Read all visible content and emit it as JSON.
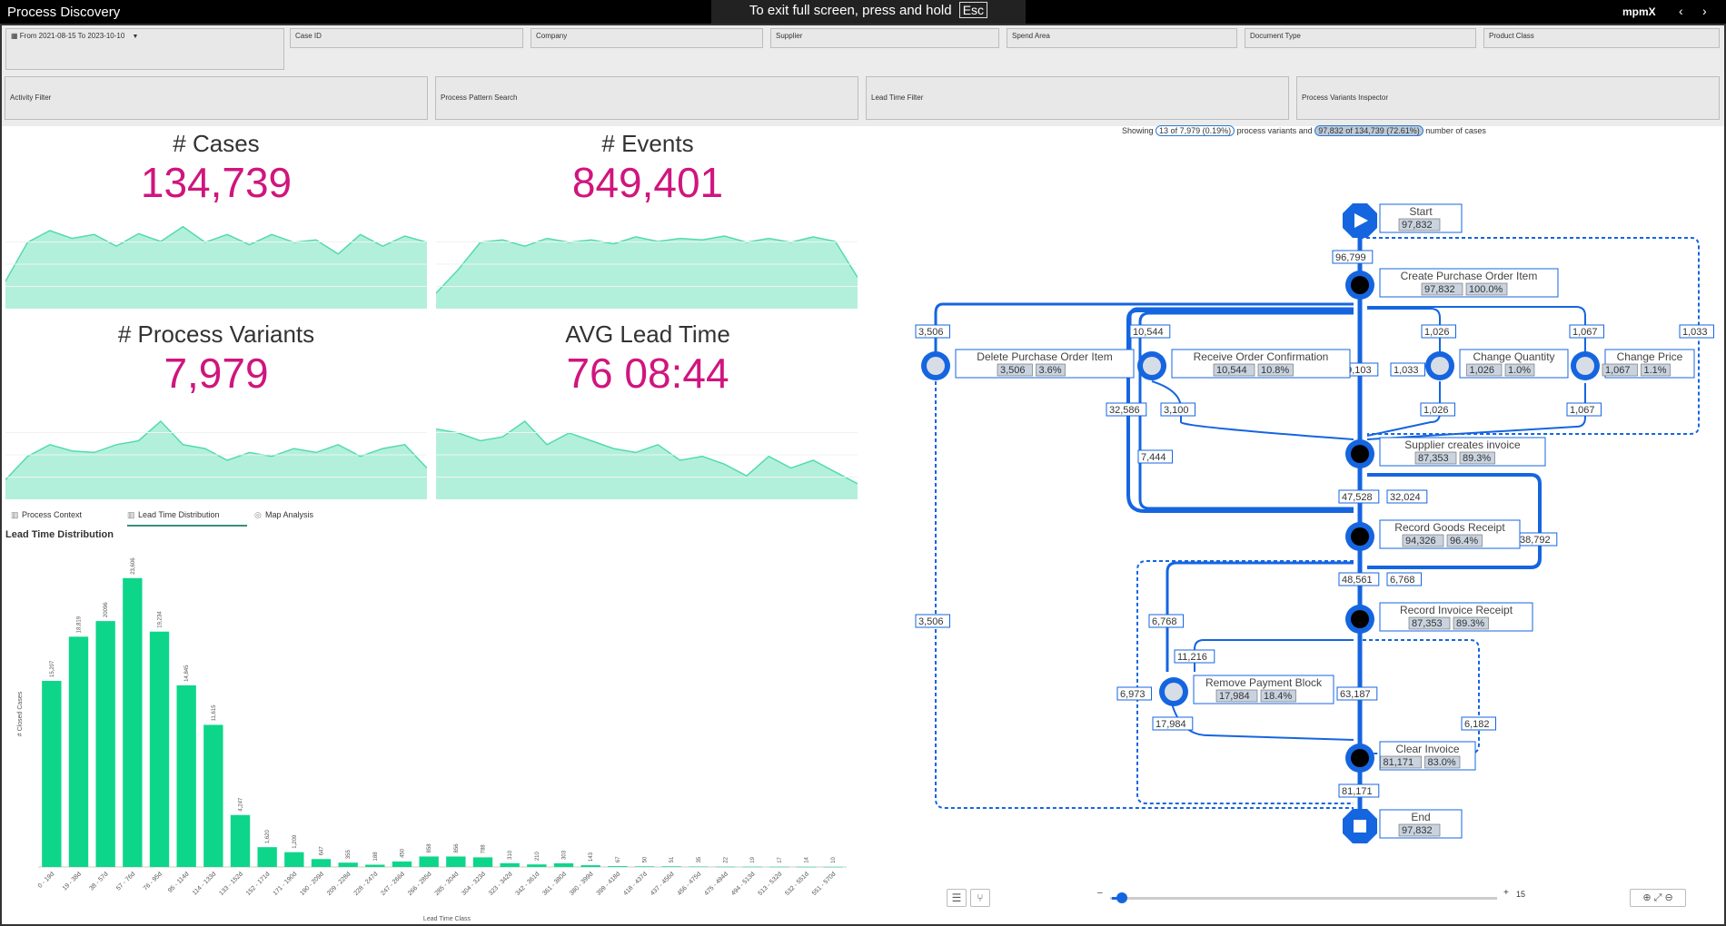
{
  "app": {
    "title": "Process Discovery",
    "logo": "mpmX",
    "fullscreen_notice": "To exit full screen, press and hold",
    "fullscreen_key": "Esc",
    "nav_prev": "‹",
    "nav_next": "›"
  },
  "filters": {
    "date_range": "From 2021-08-15 To 2023-10-10",
    "fields": [
      "Case ID",
      "Company",
      "Supplier",
      "Spend Area",
      "Document Type",
      "Product Class"
    ],
    "panels": [
      "Activity Filter",
      "Process Pattern Search",
      "Lead Time Filter",
      "Process Variants Inspector"
    ]
  },
  "kpis": [
    {
      "label": "# Cases",
      "value": "134,739",
      "trend": [
        0.35,
        0.85,
        1.0,
        0.9,
        0.95,
        0.8,
        0.96,
        0.86,
        1.05,
        0.85,
        0.95,
        0.82,
        0.95,
        0.85,
        0.88,
        0.7,
        0.95,
        0.8,
        0.93,
        0.85
      ]
    },
    {
      "label": "# Events",
      "value": "849,401",
      "trend": [
        0.2,
        0.5,
        0.85,
        0.88,
        0.8,
        0.9,
        0.85,
        0.88,
        0.83,
        0.92,
        0.86,
        0.9,
        0.88,
        0.93,
        0.85,
        0.9,
        0.85,
        0.92,
        0.86,
        0.4
      ]
    },
    {
      "label": "# Process Variants",
      "value": "7,979",
      "trend": [
        0.25,
        0.55,
        0.7,
        0.62,
        0.6,
        0.7,
        0.75,
        1.0,
        0.7,
        0.65,
        0.5,
        0.6,
        0.55,
        0.65,
        0.6,
        0.7,
        0.55,
        0.65,
        0.7,
        0.4
      ]
    },
    {
      "label": "AVG Lead Time",
      "value": "76 08:44",
      "trend": [
        0.9,
        0.85,
        0.75,
        0.8,
        1.0,
        0.7,
        0.85,
        0.75,
        0.65,
        0.6,
        0.7,
        0.5,
        0.55,
        0.45,
        0.3,
        0.55,
        0.4,
        0.5,
        0.35,
        0.2
      ]
    }
  ],
  "colors": {
    "kpi_value": "#d0157e",
    "spark_fill": "#b3f0dc",
    "spark_line": "#52dca9",
    "bar": "#0dd68a",
    "flow_blue": "#1565e0"
  },
  "tabs": [
    {
      "label": "Process Context",
      "icon": "bar-chart-icon"
    },
    {
      "label": "Lead Time Distribution",
      "icon": "bar-chart-icon"
    },
    {
      "label": "Map Analysis",
      "icon": "map-icon"
    }
  ],
  "chart_data": {
    "type": "bar",
    "title": "Lead Time Distribution",
    "xlabel": "Lead Time Class",
    "ylabel": "# Closed Cases",
    "categories": [
      "0 - 19d",
      "19 - 38d",
      "38 - 57d",
      "57 - 76d",
      "76 - 95d",
      "95 - 114d",
      "114 - 133d",
      "133 - 152d",
      "152 - 171d",
      "171 - 190d",
      "190 - 209d",
      "209 - 228d",
      "228 - 247d",
      "247 - 266d",
      "266 - 285d",
      "285 - 304d",
      "304 - 323d",
      "323 - 342d",
      "342 - 361d",
      "361 - 380d",
      "380 - 399d",
      "399 - 418d",
      "418 - 437d",
      "437 - 456d",
      "456 - 475d",
      "475 - 494d",
      "494 - 513d",
      "513 - 532d",
      "532 - 551d",
      "551 - 570d"
    ],
    "values": [
      15207,
      18819,
      20096,
      23606,
      19234,
      14845,
      11615,
      4247,
      1620,
      1209,
      647,
      355,
      188,
      450,
      858,
      856,
      788,
      310,
      210,
      303,
      143,
      67,
      50,
      51,
      35,
      22,
      19,
      17,
      14,
      10
    ],
    "labels": [
      "15,207",
      "18,819",
      "20096",
      "23,606",
      "19,234",
      "14,845",
      "11,615",
      "4,247",
      "1,620",
      "1,209",
      "647",
      "355",
      "188",
      "450",
      "858",
      "856",
      "788",
      "310",
      "210",
      "303",
      "143",
      "67",
      "50",
      "51",
      "35",
      "22",
      "19",
      "17",
      "14",
      "10"
    ],
    "ylim": [
      0,
      25000
    ]
  },
  "process_map": {
    "showing_label": "Showing",
    "variants_pill": "13 of 7,979 (0.19%)",
    "variants_text": "process variants and",
    "cases_pill": "97,832 of 134,739 (72.61%)",
    "cases_text": "number of cases",
    "nodes": [
      {
        "name": "Start",
        "count": "97,832"
      },
      {
        "name": "Create Purchase Order Item",
        "count": "97,832",
        "pct": "100.0%"
      },
      {
        "name": "Delete Purchase Order Item",
        "count": "3,506",
        "pct": "3.6%"
      },
      {
        "name": "Receive Order Confirmation",
        "count": "10,544",
        "pct": "10.8%"
      },
      {
        "name": "Change Quantity",
        "count": "1,026",
        "pct": "1.0%"
      },
      {
        "name": "Change Price",
        "count": "1,067",
        "pct": "1.1%"
      },
      {
        "name": "Supplier creates invoice",
        "count": "87,353",
        "pct": "89.3%"
      },
      {
        "name": "Record Goods Receipt",
        "count": "94,326",
        "pct": "96.4%"
      },
      {
        "name": "Record Invoice Receipt",
        "count": "87,353",
        "pct": "89.3%"
      },
      {
        "name": "Remove Payment Block",
        "count": "17,984",
        "pct": "18.4%"
      },
      {
        "name": "Clear Invoice",
        "count": "81,171",
        "pct": "83.0%"
      },
      {
        "name": "End",
        "count": "97,832"
      }
    ],
    "edges": [
      "96,799",
      "3,506",
      "10,544",
      "1,026",
      "1,067",
      "1,033",
      "49,103",
      "1,033",
      "32,586",
      "3,100",
      "1,026",
      "1,067",
      "7,444",
      "47,528",
      "32,024",
      "38,792",
      "48,561",
      "6,768",
      "6,768",
      "11,216",
      "3,506",
      "6,973",
      "63,187",
      "17,984",
      "6,182",
      "81,171"
    ],
    "slider_min": "–",
    "slider_plus": "+",
    "slider_value": "15"
  }
}
